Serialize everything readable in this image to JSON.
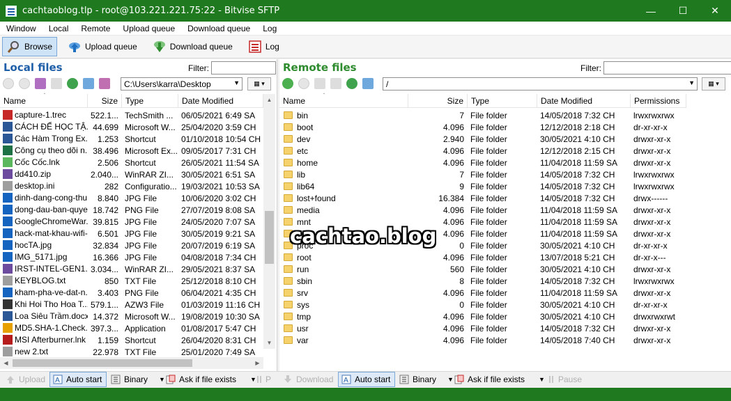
{
  "window": {
    "title": "cachtaoblog.tlp - root@103.221.221.75:22 - Bitvise SFTP",
    "minimize": "—",
    "maximize": "☐",
    "close": "✕"
  },
  "menu": [
    "Window",
    "Local",
    "Remote",
    "Upload queue",
    "Download queue",
    "Log"
  ],
  "toolbar": {
    "browse": "Browse",
    "upload_queue": "Upload queue",
    "download_queue": "Download queue",
    "log": "Log"
  },
  "local": {
    "title": "Local files",
    "filter_label": "Filter:",
    "filter_value": "",
    "path": "C:\\Users\\karra\\Desktop",
    "columns": [
      "Name",
      "Size",
      "Type",
      "Date Modified"
    ],
    "rows": [
      {
        "name": "capture-1.trec",
        "size": "522.1...",
        "type": "TechSmith ...",
        "date": "06/05/2021 6:49 SA",
        "icon": "#c62828"
      },
      {
        "name": "CÁCH ĐỂ HỌC TẬ...",
        "size": "44.699",
        "type": "Microsoft W...",
        "date": "25/04/2020 3:59 CH",
        "icon": "#2b5797"
      },
      {
        "name": "Các Hàm Trong Ex...",
        "size": "1.253",
        "type": "Shortcut",
        "date": "01/10/2018 10:54 CH",
        "icon": "#2b5797"
      },
      {
        "name": "Công cụ theo dõi n...",
        "size": "38.496",
        "type": "Microsoft Ex...",
        "date": "09/05/2017 7:31 CH",
        "icon": "#1e7145"
      },
      {
        "name": "Cốc Cốc.lnk",
        "size": "2.506",
        "type": "Shortcut",
        "date": "26/05/2021 11:54 SA",
        "icon": "#5cb85c"
      },
      {
        "name": "dd410.zip",
        "size": "2.040...",
        "type": "WinRAR ZI...",
        "date": "30/05/2021 6:51 SA",
        "icon": "#6d4c9f"
      },
      {
        "name": "desktop.ini",
        "size": "282",
        "type": "Configuratio...",
        "date": "19/03/2021 10:53 SA",
        "icon": "#9e9e9e"
      },
      {
        "name": "dinh-dang-cong-thu...",
        "size": "8.840",
        "type": "JPG File",
        "date": "10/06/2020 3:02 CH",
        "icon": "#1565c0"
      },
      {
        "name": "dong-dau-ban-quye...",
        "size": "18.742",
        "type": "PNG File",
        "date": "27/07/2019 8:08 SA",
        "icon": "#1565c0"
      },
      {
        "name": "GoogleChromeWar...",
        "size": "39.815",
        "type": "JPG File",
        "date": "24/05/2020 7:07 SA",
        "icon": "#1565c0"
      },
      {
        "name": "hack-mat-khau-wifi-...",
        "size": "6.501",
        "type": "JPG File",
        "date": "30/05/2019 9:21 SA",
        "icon": "#1565c0"
      },
      {
        "name": "hocTA.jpg",
        "size": "32.834",
        "type": "JPG File",
        "date": "20/07/2019 6:19 SA",
        "icon": "#1565c0"
      },
      {
        "name": "IMG_5171.jpg",
        "size": "16.366",
        "type": "JPG File",
        "date": "04/08/2018 7:34 CH",
        "icon": "#1565c0"
      },
      {
        "name": "IRST-INTEL-GEN1...",
        "size": "3.034...",
        "type": "WinRAR ZI...",
        "date": "29/05/2021 8:37 SA",
        "icon": "#6d4c9f"
      },
      {
        "name": "KEYBLOG.txt",
        "size": "850",
        "type": "TXT File",
        "date": "25/12/2018 8:10 CH",
        "icon": "#9e9e9e"
      },
      {
        "name": "kham-pha-ve-dat-n...",
        "size": "3.403",
        "type": "PNG File",
        "date": "06/04/2021 4:35 CH",
        "icon": "#1565c0"
      },
      {
        "name": "Khi Hoi Tho Hoa T...",
        "size": "579.1...",
        "type": "AZW3 File",
        "date": "01/03/2019 11:16 CH",
        "icon": "#333333"
      },
      {
        "name": "Loa Siêu Trầm.docx",
        "size": "14.372",
        "type": "Microsoft W...",
        "date": "19/08/2019 10:30 SA",
        "icon": "#2b5797"
      },
      {
        "name": "MD5.SHA-1.Check...",
        "size": "397.3...",
        "type": "Application",
        "date": "01/08/2017 5:47 CH",
        "icon": "#e6a100"
      },
      {
        "name": "MSI Afterburner.lnk",
        "size": "1.159",
        "type": "Shortcut",
        "date": "26/04/2020 8:31 CH",
        "icon": "#b71c1c"
      },
      {
        "name": "new 2.txt",
        "size": "22.978",
        "type": "TXT File",
        "date": "25/01/2020 7:49 SA",
        "icon": "#9e9e9e"
      }
    ]
  },
  "remote": {
    "title": "Remote files",
    "filter_label": "Filter:",
    "filter_value": "",
    "path": "/",
    "columns": [
      "Name",
      "Size",
      "Type",
      "Date Modified",
      "Permissions"
    ],
    "rows": [
      {
        "name": "bin",
        "size": "7",
        "type": "File folder",
        "date": "14/05/2018 7:32 CH",
        "perm": "lrwxrwxrwx"
      },
      {
        "name": "boot",
        "size": "4.096",
        "type": "File folder",
        "date": "12/12/2018 2:18 CH",
        "perm": "dr-xr-xr-x"
      },
      {
        "name": "dev",
        "size": "2.940",
        "type": "File folder",
        "date": "30/05/2021 4:10 CH",
        "perm": "drwxr-xr-x"
      },
      {
        "name": "etc",
        "size": "4.096",
        "type": "File folder",
        "date": "12/12/2018 2:15 CH",
        "perm": "drwxr-xr-x"
      },
      {
        "name": "home",
        "size": "4.096",
        "type": "File folder",
        "date": "11/04/2018 11:59 SA",
        "perm": "drwxr-xr-x"
      },
      {
        "name": "lib",
        "size": "7",
        "type": "File folder",
        "date": "14/05/2018 7:32 CH",
        "perm": "lrwxrwxrwx"
      },
      {
        "name": "lib64",
        "size": "9",
        "type": "File folder",
        "date": "14/05/2018 7:32 CH",
        "perm": "lrwxrwxrwx"
      },
      {
        "name": "lost+found",
        "size": "16.384",
        "type": "File folder",
        "date": "14/05/2018 7:32 CH",
        "perm": "drwx------"
      },
      {
        "name": "media",
        "size": "4.096",
        "type": "File folder",
        "date": "11/04/2018 11:59 SA",
        "perm": "drwxr-xr-x"
      },
      {
        "name": "mnt",
        "size": "4.096",
        "type": "File folder",
        "date": "11/04/2018 11:59 SA",
        "perm": "drwxr-xr-x"
      },
      {
        "name": "opt",
        "size": "4.096",
        "type": "File folder",
        "date": "11/04/2018 11:59 SA",
        "perm": "drwxr-xr-x"
      },
      {
        "name": "proc",
        "size": "0",
        "type": "File folder",
        "date": "30/05/2021 4:10 CH",
        "perm": "dr-xr-xr-x"
      },
      {
        "name": "root",
        "size": "4.096",
        "type": "File folder",
        "date": "13/07/2018 5:21 CH",
        "perm": "dr-xr-x---"
      },
      {
        "name": "run",
        "size": "560",
        "type": "File folder",
        "date": "30/05/2021 4:10 CH",
        "perm": "drwxr-xr-x"
      },
      {
        "name": "sbin",
        "size": "8",
        "type": "File folder",
        "date": "14/05/2018 7:32 CH",
        "perm": "lrwxrwxrwx"
      },
      {
        "name": "srv",
        "size": "4.096",
        "type": "File folder",
        "date": "11/04/2018 11:59 SA",
        "perm": "drwxr-xr-x"
      },
      {
        "name": "sys",
        "size": "0",
        "type": "File folder",
        "date": "30/05/2021 4:10 CH",
        "perm": "dr-xr-xr-x"
      },
      {
        "name": "tmp",
        "size": "4.096",
        "type": "File folder",
        "date": "30/05/2021 4:10 CH",
        "perm": "drwxrwxrwt"
      },
      {
        "name": "usr",
        "size": "4.096",
        "type": "File folder",
        "date": "14/05/2018 7:32 CH",
        "perm": "drwxr-xr-x"
      },
      {
        "name": "var",
        "size": "4.096",
        "type": "File folder",
        "date": "14/05/2018 7:40 CH",
        "perm": "drwxr-xr-x"
      }
    ]
  },
  "bottom_left": {
    "upload": "Upload",
    "auto_start": "Auto start",
    "binary": "Binary",
    "ask": "Ask if file exists",
    "pause_fragment": "P"
  },
  "bottom_right": {
    "download": "Download",
    "auto_start": "Auto start",
    "binary": "Binary",
    "ask": "Ask if file exists",
    "pause": "Pause"
  },
  "watermark": "cachtao.blog",
  "colors": {
    "title_bar": "#1f7a1f",
    "local_title": "#1f5fa8",
    "remote_title": "#2e8b2e"
  }
}
